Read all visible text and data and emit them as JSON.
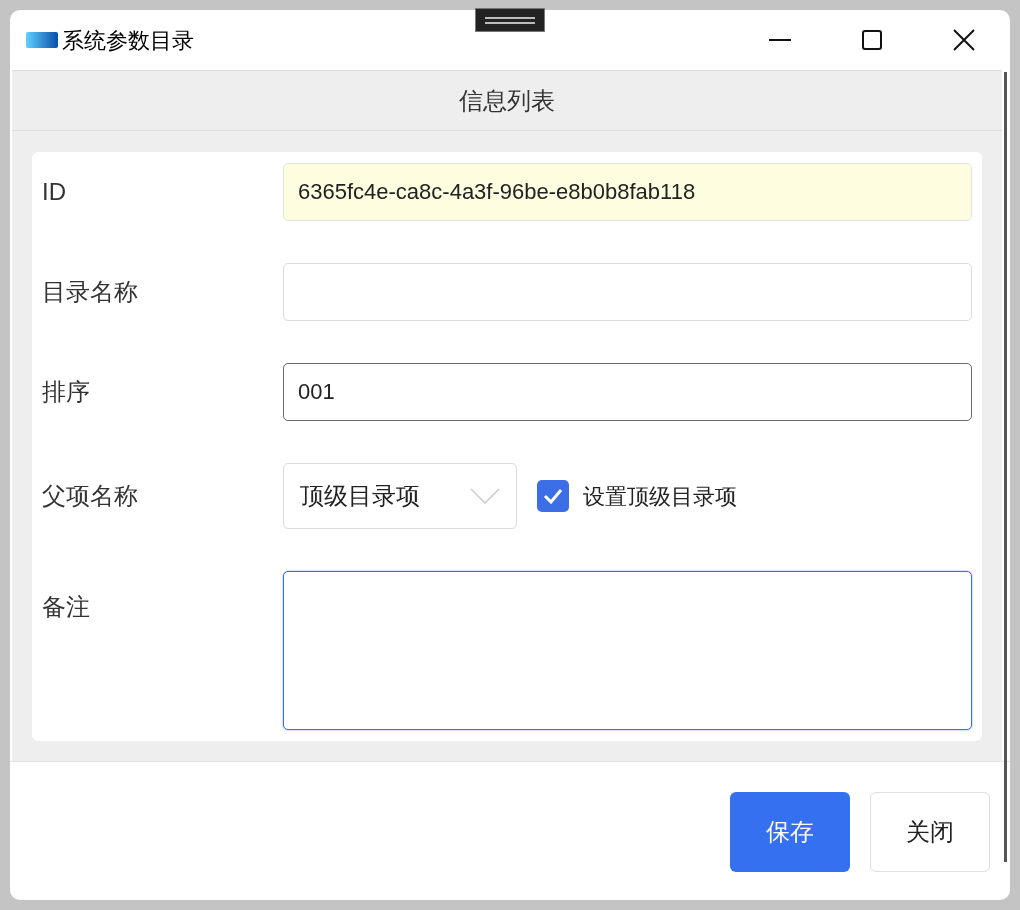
{
  "window": {
    "title": "系统参数目录"
  },
  "header": {
    "title": "信息列表"
  },
  "fields": [
    {
      "kind": "text",
      "label": "ID",
      "value": "6365fc4e-ca8c-4a3f-96be-e8b0b8fab118",
      "readonly": true,
      "hovered": false,
      "focused": false
    },
    {
      "kind": "text",
      "label": "目录名称",
      "readonly": false,
      "hovered": false,
      "focused": false
    },
    {
      "kind": "text",
      "label": "排序",
      "value": "001",
      "readonly": false,
      "hovered": true,
      "focused": false
    },
    {
      "kind": "select",
      "label": "父项名称",
      "value": "顶级目录项",
      "readonly": false,
      "hovered": false,
      "focused": false,
      "checkbox": {
        "label": "设置顶级目录项",
        "checked": true
      }
    },
    {
      "kind": "textarea",
      "label": "备注",
      "readonly": false,
      "hovered": false,
      "focused": true
    }
  ],
  "buttons": [
    {
      "label": "保存",
      "primary": true
    },
    {
      "label": "关闭",
      "primary": false
    }
  ]
}
